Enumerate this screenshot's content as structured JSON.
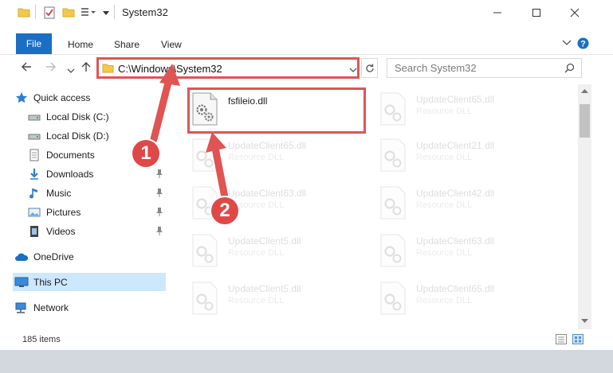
{
  "window": {
    "title": "System32",
    "caption_icons": [
      "minimize-icon",
      "maximize-icon",
      "close-icon"
    ]
  },
  "ribbon": {
    "tabs": [
      {
        "label": "File"
      },
      {
        "label": "Home"
      },
      {
        "label": "Share"
      },
      {
        "label": "View"
      }
    ]
  },
  "address": {
    "path": "C:\\Windows\\System32",
    "search_placeholder": "Search System32"
  },
  "navpane": {
    "items": [
      {
        "label": "Quick access",
        "icon": "star-icon",
        "pinned": false
      },
      {
        "label": "Local Disk (C:)",
        "icon": "drive-icon",
        "pinned": false
      },
      {
        "label": "Local Disk (D:)",
        "icon": "drive-icon",
        "pinned": false
      },
      {
        "label": "Documents",
        "icon": "documents-icon",
        "pinned": false
      },
      {
        "label": "Downloads",
        "icon": "download-icon",
        "pinned": true
      },
      {
        "label": "Music",
        "icon": "music-icon",
        "pinned": true
      },
      {
        "label": "Pictures",
        "icon": "pictures-icon",
        "pinned": true
      },
      {
        "label": "Videos",
        "icon": "videos-icon",
        "pinned": true
      },
      {
        "label": "OneDrive",
        "icon": "onedrive-icon",
        "pinned": false
      },
      {
        "label": "This PC",
        "icon": "computer-icon",
        "pinned": false,
        "selected": true
      },
      {
        "label": "Network",
        "icon": "network-icon",
        "pinned": false
      }
    ]
  },
  "files": {
    "highlighted": {
      "name": "fsfileio.dll"
    },
    "faded": [
      {
        "name": "UpdateClient65.dll",
        "type": "Resource DLL"
      },
      {
        "name": "UpdateClient65.dll",
        "type": "Resource DLL"
      },
      {
        "name": "UpdateClient21.dll",
        "type": "Resource DLL"
      },
      {
        "name": "UpdateClient63.dll",
        "type": "Resource DLL"
      },
      {
        "name": "UpdateClient42.dll",
        "type": "Resource DLL"
      },
      {
        "name": "UpdateClient5.dll",
        "type": "Resource DLL"
      },
      {
        "name": "UpdateClient63.dll",
        "type": "Resource DLL"
      },
      {
        "name": "UpdateClient5.dll",
        "type": "Resource DLL"
      },
      {
        "name": "UpdateClient65.dll",
        "type": "Resource DLL"
      }
    ]
  },
  "status": {
    "item_count": "185 items"
  },
  "callouts": [
    {
      "label": "1"
    },
    {
      "label": "2"
    }
  ],
  "colors": {
    "accent": "#1a6fc4",
    "highlight_red": "#e05454",
    "selection": "#cce8ff"
  }
}
